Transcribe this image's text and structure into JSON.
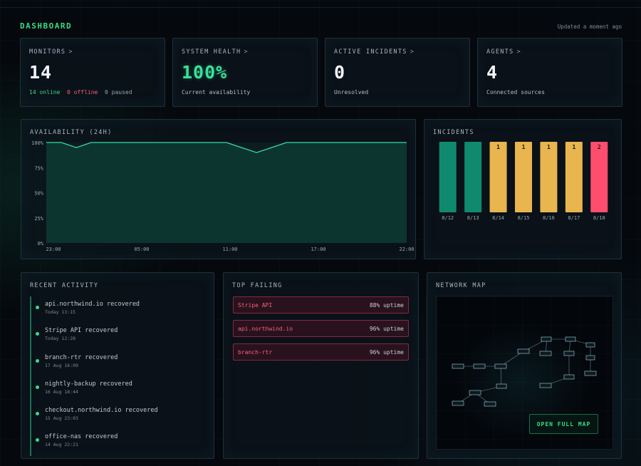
{
  "header": {
    "title": "DASHBOARD",
    "updated": "Updated a moment ago"
  },
  "stats": {
    "monitors": {
      "label": "MONITORS",
      "value": "14",
      "online": "14 online",
      "offline": "0 offline",
      "paused": "0 paused"
    },
    "health": {
      "label": "SYSTEM HEALTH",
      "value": "100%",
      "sub": "Current availability"
    },
    "incidents": {
      "label": "ACTIVE INCIDENTS",
      "value": "0",
      "sub": "Unresolved"
    },
    "agents": {
      "label": "AGENTS",
      "value": "4",
      "sub": "Connected sources"
    },
    "chevron": ">"
  },
  "availability": {
    "title": "AVAILABILITY (24H)"
  },
  "incidents_panel": {
    "title": "INCIDENTS"
  },
  "chart_data": [
    {
      "type": "area",
      "title": "AVAILABILITY (24H)",
      "x": [
        0,
        1,
        2,
        3,
        4,
        5,
        6,
        7,
        8,
        9,
        10,
        11,
        12,
        13,
        14,
        15,
        16,
        17,
        18,
        19,
        20,
        21,
        22,
        23,
        24
      ],
      "values": [
        100,
        100,
        95,
        100,
        100,
        100,
        100,
        100,
        100,
        100,
        100,
        100,
        100,
        95,
        90,
        95,
        100,
        100,
        100,
        100,
        100,
        100,
        100,
        100,
        100
      ],
      "xticks": [
        "23:00",
        "05:00",
        "11:00",
        "17:00",
        "22:00"
      ],
      "yticks": [
        "0%",
        "25%",
        "50%",
        "75%",
        "100%"
      ],
      "ylim": [
        0,
        100
      ],
      "colors": {
        "line": "#39d9a8",
        "fill": "#0e3a33"
      }
    },
    {
      "type": "bar",
      "title": "INCIDENTS",
      "categories": [
        "8/12",
        "8/13",
        "8/14",
        "8/15",
        "8/16",
        "8/17",
        "8/18"
      ],
      "values": [
        0,
        0,
        1,
        1,
        1,
        1,
        2
      ],
      "labels": [
        "",
        "",
        "1",
        "1",
        "1",
        "1",
        "2"
      ],
      "colors": [
        "#108a6e",
        "#108a6e",
        "#e8b54e",
        "#e8b54e",
        "#e8b54e",
        "#e8b54e",
        "#ff4d6d"
      ]
    }
  ],
  "recent": {
    "title": "RECENT ACTIVITY",
    "items": [
      {
        "name": "api.northwind.io recovered",
        "time": "Today 13:15"
      },
      {
        "name": "Stripe API recovered",
        "time": "Today 12:28"
      },
      {
        "name": "branch-rtr recovered",
        "time": "17 Aug 16:09"
      },
      {
        "name": "nightly-backup recovered",
        "time": "16 Aug 18:44"
      },
      {
        "name": "checkout.northwind.io recovered",
        "time": "15 Aug 23:03"
      },
      {
        "name": "office-nas recovered",
        "time": "14 Aug 22:21"
      }
    ]
  },
  "failing": {
    "title": "TOP FAILING",
    "items": [
      {
        "name": "Stripe API",
        "uptime": "88% uptime"
      },
      {
        "name": "api.northwind.io",
        "uptime": "96% uptime"
      },
      {
        "name": "branch-rtr",
        "uptime": "96% uptime"
      }
    ]
  },
  "network": {
    "title": "NETWORK MAP",
    "button": "OPEN FULL MAP"
  }
}
